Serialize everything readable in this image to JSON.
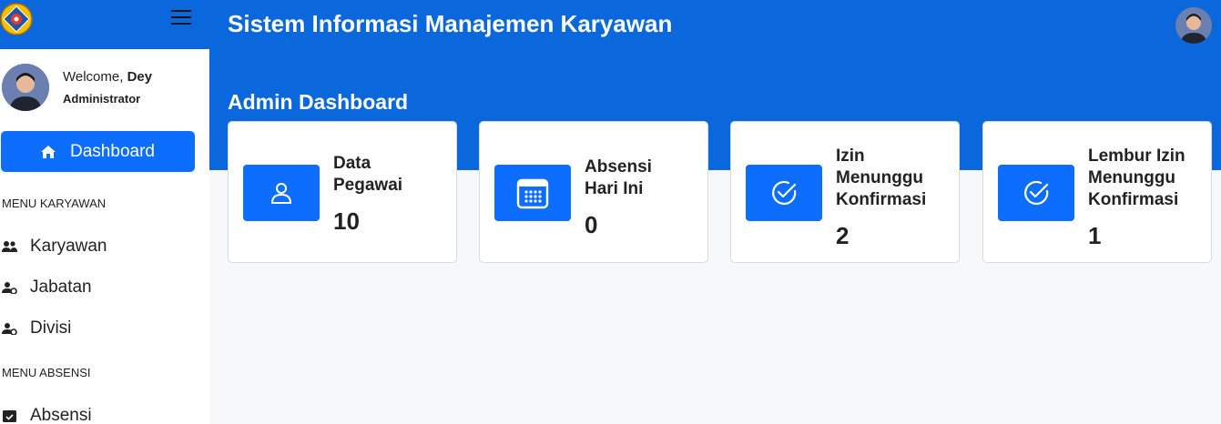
{
  "app": {
    "title": "Sistem Informasi Manajemen Karyawan",
    "page_title": "Admin Dashboard"
  },
  "user": {
    "welcome_prefix": "Welcome, ",
    "name": "Dey",
    "role": "Administrator"
  },
  "sidebar": {
    "dashboard_label": "Dashboard",
    "sections": [
      {
        "label": "MENU KARYAWAN",
        "items": [
          {
            "label": "Karyawan",
            "icon": "users-icon"
          },
          {
            "label": "Jabatan",
            "icon": "user-cog-icon"
          },
          {
            "label": "Divisi",
            "icon": "user-cog-icon"
          }
        ]
      },
      {
        "label": "MENU ABSENSI",
        "items": [
          {
            "label": "Absensi",
            "icon": "calendar-check-icon"
          }
        ]
      }
    ]
  },
  "cards": [
    {
      "label_lines": [
        "Data",
        "Pegawai"
      ],
      "value": "10",
      "icon": "user-icon"
    },
    {
      "label_lines": [
        "Absensi",
        "Hari Ini"
      ],
      "value": "0",
      "icon": "calendar-icon"
    },
    {
      "label_lines": [
        "Izin",
        "Menunggu",
        "Konfirmasi"
      ],
      "value": "2",
      "icon": "check-circle-icon"
    },
    {
      "label_lines": [
        "Lembur Izin",
        "Menunggu",
        "Konfirmasi"
      ],
      "value": "1",
      "icon": "check-circle-icon"
    }
  ],
  "colors": {
    "primary": "#0d6efd",
    "header": "#0a68dc"
  }
}
